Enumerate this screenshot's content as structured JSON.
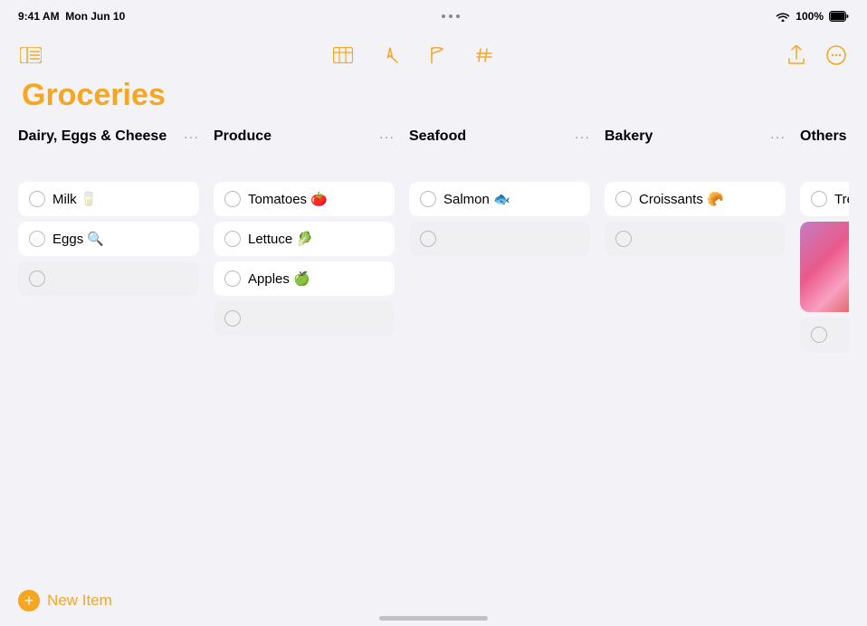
{
  "statusBar": {
    "time": "9:41 AM",
    "date": "Mon Jun 10",
    "dots": 3,
    "wifi": true,
    "battery": "100%"
  },
  "toolbar": {
    "sidebarIcon": "sidebar",
    "centerIcons": [
      "table-icon",
      "navigate-icon",
      "flag-icon",
      "hashtag-icon"
    ],
    "rightIcons": [
      "share-icon",
      "more-icon"
    ]
  },
  "page": {
    "title": "Groceries"
  },
  "columns": [
    {
      "id": "dairy",
      "title": "Dairy, Eggs & Cheese",
      "items": [
        {
          "text": "Milk 🥛",
          "checked": false
        },
        {
          "text": "Eggs 🔍",
          "checked": false
        }
      ],
      "emptySlot": true
    },
    {
      "id": "produce",
      "title": "Produce",
      "items": [
        {
          "text": "Tomatoes 🍅",
          "checked": false
        },
        {
          "text": "Lettuce 🥬",
          "checked": false
        },
        {
          "text": "Apples 🍏",
          "checked": false
        }
      ],
      "emptySlot": true
    },
    {
      "id": "seafood",
      "title": "Seafood",
      "items": [
        {
          "text": "Salmon 🐟",
          "checked": false
        }
      ],
      "emptySlot": true
    },
    {
      "id": "bakery",
      "title": "Bakery",
      "items": [
        {
          "text": "Croissants 🥐",
          "checked": false
        }
      ],
      "emptySlot": true
    },
    {
      "id": "others",
      "title": "Others",
      "items": [
        {
          "text": "Treats for",
          "checked": false
        }
      ],
      "hasImage": true,
      "emptySlot": true
    }
  ],
  "newItemButton": {
    "label": "New Item",
    "icon": "+"
  }
}
